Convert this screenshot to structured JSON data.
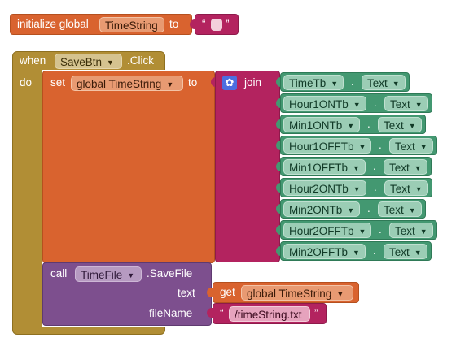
{
  "init_block": {
    "prefix": "initialize global",
    "var_name": "TimeString",
    "to": "to",
    "quote_open": "“",
    "quote_close": "”"
  },
  "event_block": {
    "when": "when",
    "component": "SaveBtn",
    "event": ".Click",
    "do": "do"
  },
  "set_block": {
    "set": "set",
    "var": "global TimeString",
    "to": "to"
  },
  "join_block": {
    "label": "join",
    "items": [
      {
        "component": "TimeTb",
        "property": "Text"
      },
      {
        "component": "Hour1ONTb",
        "property": "Text"
      },
      {
        "component": "Min1ONTb",
        "property": "Text"
      },
      {
        "component": "Hour1OFFTb",
        "property": "Text"
      },
      {
        "component": "Min1OFFTb",
        "property": "Text"
      },
      {
        "component": "Hour2ONTb",
        "property": "Text"
      },
      {
        "component": "Min2ONTb",
        "property": "Text"
      },
      {
        "component": "Hour2OFFTb",
        "property": "Text"
      },
      {
        "component": "Min2OFFTb",
        "property": "Text"
      }
    ],
    "dot": "."
  },
  "call_block": {
    "call": "call",
    "component": "TimeFile",
    "method": ".SaveFile",
    "arg_text": "text",
    "arg_filename": "fileName"
  },
  "get_block": {
    "get": "get",
    "var": "global TimeString"
  },
  "filename_block": {
    "quote_open": "“",
    "value": "/timeString.txt",
    "quote_close": "”"
  },
  "colors": {
    "variables": "#d9632f",
    "event": "#b18e35",
    "text": "#b3235f",
    "component": "#439871",
    "method": "#7d4f8e"
  },
  "icons": {
    "dropdown": "triangle-down",
    "join_mutator": "gear-icon"
  }
}
